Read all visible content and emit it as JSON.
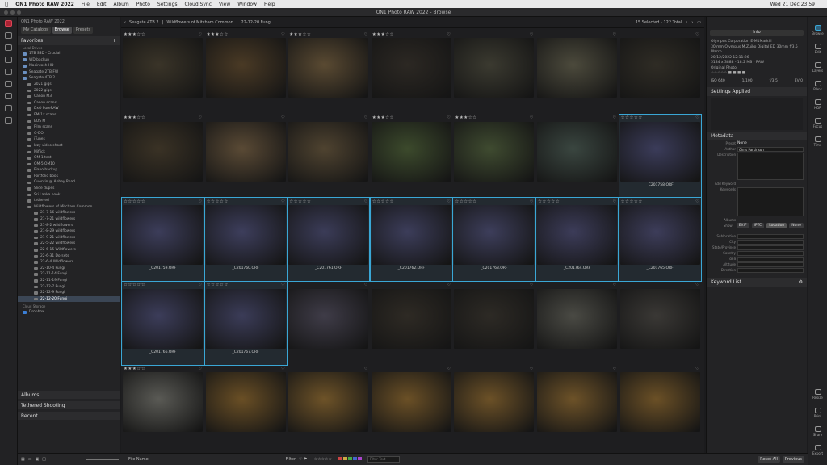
{
  "menubar": {
    "apple": "",
    "app": "ON1 Photo RAW 2022",
    "menus": [
      "File",
      "Edit",
      "Album",
      "Photo",
      "Settings",
      "Cloud Sync",
      "View",
      "Window",
      "Help"
    ],
    "clock": "Wed 21 Dec  23:59"
  },
  "window": {
    "title": "ON1 Photo RAW 2022 - Browse"
  },
  "sidebar": {
    "appname": "ON1 Photo RAW 2022",
    "tabs": [
      "My Catalogs",
      "Browse",
      "Presets"
    ],
    "favorites_label": "Favorites",
    "local_drives": "Local Drives",
    "drives": [
      "1TB SSD - Crucial",
      "WD backup",
      "Macintosh HD",
      "Seagate 2TB FW",
      "Seagate 4TB 2"
    ],
    "folders": [
      "2021 gigs",
      "2022 gigs",
      "Canon M3",
      "Canon scans",
      "DxO PureRAW",
      "EM-1x scans",
      "EOS M",
      "Film scans",
      "G-DO",
      "iTunes",
      "Izzy video shoot",
      "Miflick",
      "OM-1 test",
      "OM-5 OM10",
      "Piano backup",
      "Portfolio book",
      "Quentin @ Abbey Road",
      "Slide dupes",
      "Sri Lanka book",
      "tethered"
    ],
    "open_folder": "Wildflowers of Mitcham Common",
    "subfolders": [
      "21-7-16 wildflowers",
      "21-7-21 wildflowers",
      "21-8-2 wildflowers",
      "21-8-29 wildflowers",
      "21-9-21 wildflowers",
      "22-5-22 wildflowers",
      "22-6-15 Wildflowers",
      "22-6-31 Dorsets",
      "22-6-4 Wildflowers",
      "22-10-4 Fungi",
      "22-11-14 Fungi",
      "22-11-19 Fungi",
      "22-12-7 Fungi",
      "22-12-9 Fungi",
      "22-12-20 Fungi"
    ],
    "cloud_storage": "Cloud Storage",
    "dropbox": "Dropbox",
    "albums": "Albums",
    "tethered": "Tethered Shooting",
    "recent": "Recent"
  },
  "pathbar": {
    "crumb1": "Seagate 4TB 2",
    "crumb2": "Wildflowers of Mitcham Common",
    "crumb3": "22-12-20 Fungi",
    "count": "15 Selected - 122 Total"
  },
  "grid": {
    "rows": [
      {
        "stars": [
          "★★★☆☆",
          "★★★☆☆",
          "★★★☆☆",
          "★★★☆☆",
          "",
          "",
          ""
        ],
        "names": [
          "",
          "",
          "",
          "",
          "",
          "",
          ""
        ],
        "sel": [
          0,
          0,
          0,
          0,
          0,
          0,
          0
        ]
      },
      {
        "stars": [
          "★★★☆☆",
          "",
          "",
          "★★★☆☆",
          "★★★☆☆",
          "",
          "☆☆☆☆☆"
        ],
        "names": [
          "",
          "",
          "",
          "",
          "",
          "",
          "_C201758.ORF"
        ],
        "sel": [
          0,
          0,
          0,
          0,
          0,
          0,
          1
        ]
      },
      {
        "stars": [
          "☆☆☆☆☆",
          "☆☆☆☆☆",
          "☆☆☆☆☆",
          "☆☆☆☆☆",
          "☆☆☆☆☆",
          "☆☆☆☆☆",
          "☆☆☆☆☆"
        ],
        "names": [
          "_C201759.ORF",
          "_C201760.ORF",
          "_C201761.ORF",
          "_C201762.ORF",
          "_C201763.ORF",
          "_C201764.ORF",
          "_C201765.ORF"
        ],
        "sel": [
          1,
          1,
          1,
          1,
          1,
          1,
          1
        ]
      },
      {
        "stars": [
          "☆☆☆☆☆",
          "☆☆☆☆☆",
          "",
          "",
          "",
          "",
          ""
        ],
        "names": [
          "_C201766.ORF",
          "_C201767.ORF",
          "",
          "",
          "",
          "",
          ""
        ],
        "sel": [
          1,
          1,
          0,
          0,
          0,
          0,
          0
        ]
      },
      {
        "stars": [
          "★★★☆☆",
          "",
          "",
          "",
          "",
          "",
          ""
        ],
        "names": [
          "",
          "",
          "",
          "",
          "",
          "",
          ""
        ],
        "sel": [
          0,
          0,
          0,
          0,
          0,
          0,
          0
        ]
      }
    ],
    "colors": [
      [
        "#3a3428",
        "#4a3a25",
        "#5a4a32",
        "#2c2823",
        "#3b3a30",
        "#4c4a3c",
        "#2f2c25"
      ],
      [
        "#3a3225",
        "#5a4a35",
        "#4f4330",
        "#3c4a2c",
        "#3f4b30",
        "#3a4640",
        "#3b3c5a"
      ],
      [
        "#3c3d5a",
        "#3d3e5c",
        "#3b3c58",
        "#3c3d5a",
        "#3d3e5b",
        "#3c3c59",
        "#3d3d5a"
      ],
      [
        "#3c3d5a",
        "#3b3c58",
        "#3f3c48",
        "#2e2a24",
        "#2d2a25",
        "#4a4a44",
        "#3a3835"
      ],
      [
        "#5a5a55",
        "#6a4f25",
        "#6e5328",
        "#6b5026",
        "#6c5127",
        "#6d5228",
        "#6b5026"
      ]
    ]
  },
  "rightpanel": {
    "info_btn": "Info",
    "camera": "Olympus Corporation E-M1MarkIII",
    "lens": "30 mm Olympus M.Zuiko Digital ED 30mm f/3.5 Macro",
    "date": "20/12/2022 12:11:26",
    "dims": "5184 x 3888 - 18.2 MB - RAW",
    "orig": "Original Photo",
    "exif": [
      "ISO 640",
      "1/100",
      "f/3.5",
      "EV 0"
    ],
    "settings_applied": "Settings Applied",
    "metadata": "Metadata",
    "preset_label": "Preset",
    "preset_value": "None",
    "author_label": "Author",
    "author_value": "Chris Parkinson",
    "description_label": "Description",
    "add_keyword": "Add Keyword",
    "keywords_label": "Keywords",
    "albums_label": "Albums",
    "show_label": "Show",
    "show_opts": [
      "EXIF",
      "IPTC",
      "Location",
      "None"
    ],
    "loc_fields": [
      "Sublocation",
      "City",
      "State/Province",
      "Country",
      "GPS",
      "Altitude",
      "Direction"
    ],
    "keyword_list": "Keyword List"
  },
  "rightstrip": {
    "items": [
      "Browse",
      "Edit",
      "Layers",
      "Plans",
      "HDR",
      "Focus",
      "Time",
      "Resize",
      "Print",
      "Share",
      "Export"
    ]
  },
  "bottombar": {
    "sort": "File Name",
    "filter": "Filter",
    "search_placeholder": "Filter Text",
    "reset": "Reset All",
    "previous": "Previous"
  }
}
